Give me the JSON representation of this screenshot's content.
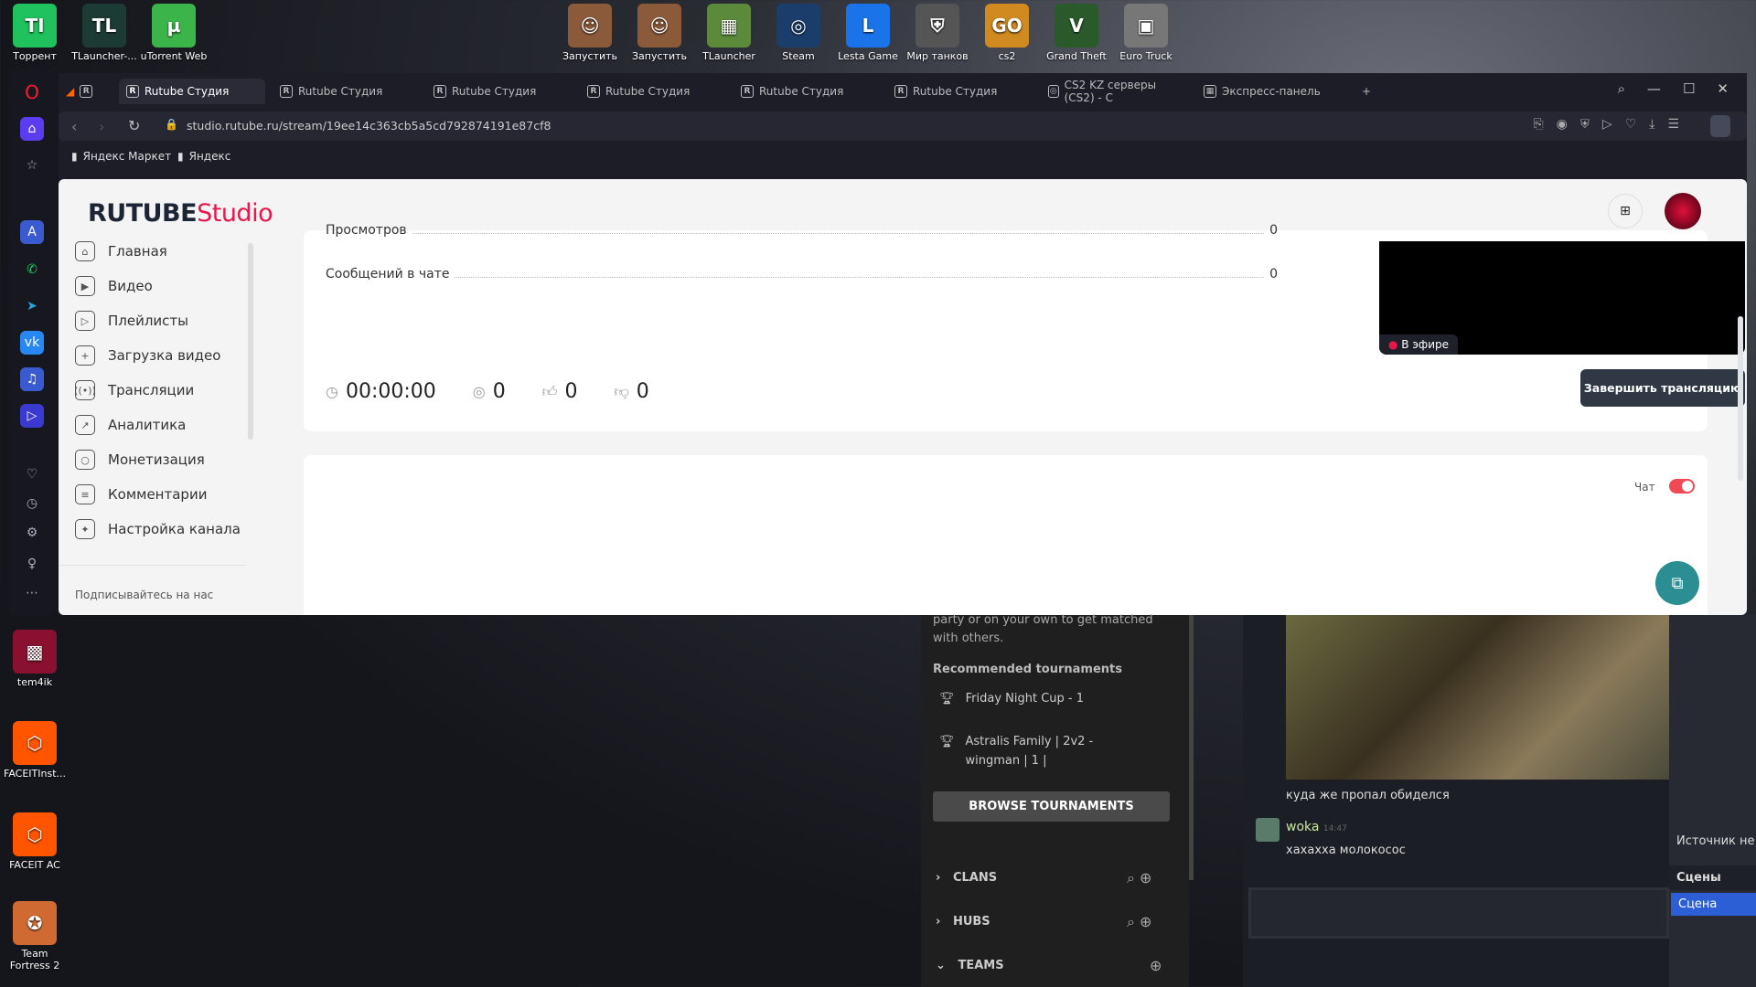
{
  "desktop": {
    "top_icons": [
      {
        "label": "Торрент",
        "glyph": "TI",
        "color": "#1fc25c"
      },
      {
        "label": "TLauncher-...",
        "glyph": "TL",
        "color": "#1d3b35"
      },
      {
        "label": "uTorrent Web",
        "glyph": "µ",
        "color": "#3bb54a"
      },
      {
        "label": "Запустить",
        "glyph": "☺",
        "color": "#8a5a3a"
      },
      {
        "label": "Запустить",
        "glyph": "☺",
        "color": "#8a5a3a"
      },
      {
        "label": "TLauncher",
        "glyph": "▦",
        "color": "#5a8a3a"
      },
      {
        "label": "Steam",
        "glyph": "◎",
        "color": "#1b3d6b"
      },
      {
        "label": "Lesta Game",
        "glyph": "L",
        "color": "#1a73e8"
      },
      {
        "label": "Мир танков",
        "glyph": "⛨",
        "color": "#555"
      },
      {
        "label": "cs2",
        "glyph": "GO",
        "color": "#d08a20"
      },
      {
        "label": "Grand Theft",
        "glyph": "V",
        "color": "#2a5a2a"
      },
      {
        "label": "Euro Truck",
        "glyph": "▣",
        "color": "#777"
      }
    ],
    "left_icons": [
      {
        "label": "tem4ik",
        "glyph": "▩",
        "color": "#8a1030"
      },
      {
        "label": "FACEITInst...",
        "glyph": "⬡",
        "color": "#ff5500"
      },
      {
        "label": "FACEIT AC",
        "glyph": "⬡",
        "color": "#ff5500"
      },
      {
        "label": "Team Fortress 2",
        "glyph": "✪",
        "color": "#cf6a32"
      }
    ]
  },
  "browser": {
    "tabs": [
      "Rutube Студия",
      "Rutube Студия",
      "Rutube Студия",
      "Rutube Студия",
      "Rutube Студия",
      "Rutube Студия",
      "CS2 KZ серверы (CS2) - C",
      "Экспресс-панель"
    ],
    "url": "studio.rutube.ru/stream/19ee14c363cb5a5cd792874191e87cf8",
    "bookmarks": [
      "Яндекс Маркет",
      "Яндекс"
    ]
  },
  "studio": {
    "logo_main": "RUTUBE",
    "logo_sub": "Studio",
    "nav": [
      {
        "label": "Главная",
        "icon": "home-icon",
        "g": "⌂"
      },
      {
        "label": "Видео",
        "icon": "video-icon",
        "g": "▶"
      },
      {
        "label": "Плейлисты",
        "icon": "playlist-icon",
        "g": "▷"
      },
      {
        "label": "Загрузка видео",
        "icon": "upload-icon",
        "g": "+"
      },
      {
        "label": "Трансляции",
        "icon": "broadcast-icon",
        "g": "((•))"
      },
      {
        "label": "Аналитика",
        "icon": "analytics-icon",
        "g": "↗"
      },
      {
        "label": "Монетизация",
        "icon": "coin-icon",
        "g": "○"
      },
      {
        "label": "Комментарии",
        "icon": "comments-icon",
        "g": "≡"
      },
      {
        "label": "Настройка канала",
        "icon": "wand-icon",
        "g": "✦"
      }
    ],
    "follow_us": "Подписывайтесь на нас",
    "rows": [
      {
        "label": "Просмотров",
        "value": "0"
      },
      {
        "label": "Сообщений в чате",
        "value": "0"
      }
    ],
    "stats": {
      "duration": "00:00:00",
      "viewers": "0",
      "likes": "0",
      "dislikes": "0"
    },
    "live_badge": "В эфире",
    "end_button": "Завершить трансляцию",
    "chat_label": "Чат",
    "chat_enabled": true,
    "accent": "#e8174a"
  },
  "faceit": {
    "intro": "party or on your own to get matched with others.",
    "rec_title": "Recommended tournaments",
    "tournaments": [
      "Friday Night Cup - 1",
      "Astralis Family | 2v2 - wingman | 1 |"
    ],
    "browse": "BROWSE TOURNAMENTS",
    "sections": [
      "CLANS",
      "HUBS",
      "TEAMS"
    ]
  },
  "chat": {
    "message1": "куда же пропал обиделся",
    "user": "woka",
    "time": "14:47",
    "message2": "хахахха молокосос"
  },
  "obs": {
    "source": "Источник не в",
    "scenes_title": "Сцены",
    "scene": "Сцена"
  }
}
